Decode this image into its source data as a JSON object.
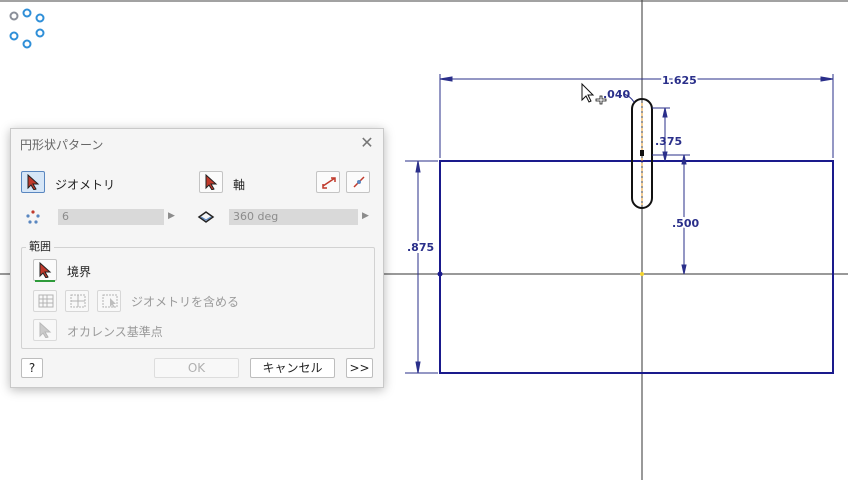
{
  "dialog": {
    "title": "円形状パターン",
    "geometry_label": "ジオメトリ",
    "axis_label": "軸",
    "count_value": "6",
    "angle_value": "360 deg",
    "range_group_title": "範囲",
    "boundary_label": "境界",
    "include_geometry_label": "ジオメトリを含める",
    "occurrence_label": "オカレンス基準点",
    "ok_label": "OK",
    "cancel_label": "キャンセル",
    "more_label": ">>",
    "help_label": "?"
  },
  "sketch": {
    "dim_overall_width": "1.625",
    "dim_slot_width": ".040",
    "dim_slot_top": ".375",
    "dim_center_offset": ".500",
    "dim_overall_height": ".875",
    "line_color": "#1a1a8c"
  }
}
